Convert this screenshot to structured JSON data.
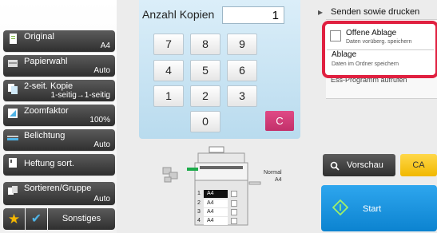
{
  "left_menu": {
    "items": [
      {
        "label": "Original",
        "value": "A4",
        "icon": "document-icon"
      },
      {
        "label": "Papierwahl",
        "value": "Auto",
        "icon": "paper-tray-icon"
      },
      {
        "label": "2-seit. Kopie",
        "value": "1-seitig→1-seitig",
        "icon": "duplex-icon"
      },
      {
        "label": "Zoomfaktor",
        "value": "100%",
        "icon": "zoom-icon"
      },
      {
        "label": "Belichtung",
        "value": "Auto",
        "icon": "exposure-icon"
      },
      {
        "label": "Heftung sort.",
        "value": "",
        "icon": "staple-sort-icon"
      },
      {
        "label": "Sortieren/Gruppe",
        "value": "Auto",
        "icon": "sort-group-icon"
      }
    ],
    "favorite_icon": "star-icon",
    "check_icon": "check-icon",
    "others_label": "Sonstiges"
  },
  "keypad": {
    "title": "Anzahl Kopien",
    "value": "1",
    "keys": [
      "7",
      "8",
      "9",
      "4",
      "5",
      "6",
      "1",
      "2",
      "3",
      "0"
    ],
    "clear_label": "C",
    "clear_color": "#d23a78"
  },
  "machine": {
    "normal_label": "Normal",
    "output_size": "A4",
    "trays": [
      {
        "number": "1",
        "size": "A4"
      },
      {
        "number": "2",
        "size": "A4"
      },
      {
        "number": "3",
        "size": "A4"
      },
      {
        "number": "4",
        "size": "A4"
      }
    ]
  },
  "right_panel": {
    "send_print_label": "Senden sowie drucken",
    "popup": {
      "option1_title": "Offene Ablage",
      "option1_subtitle": "Daten vorüberg. speichern",
      "option2_title": "Ablage",
      "option2_subtitle": "Daten im Ordner speichern",
      "border_color": "#e02040"
    },
    "partial_row_label": "Ess-Programm aufrufen",
    "preview_label": "Vorschau",
    "ca_label": "CA",
    "start_label": "Start",
    "start_color": "#1a93dc",
    "ca_color": "#f5c518"
  }
}
